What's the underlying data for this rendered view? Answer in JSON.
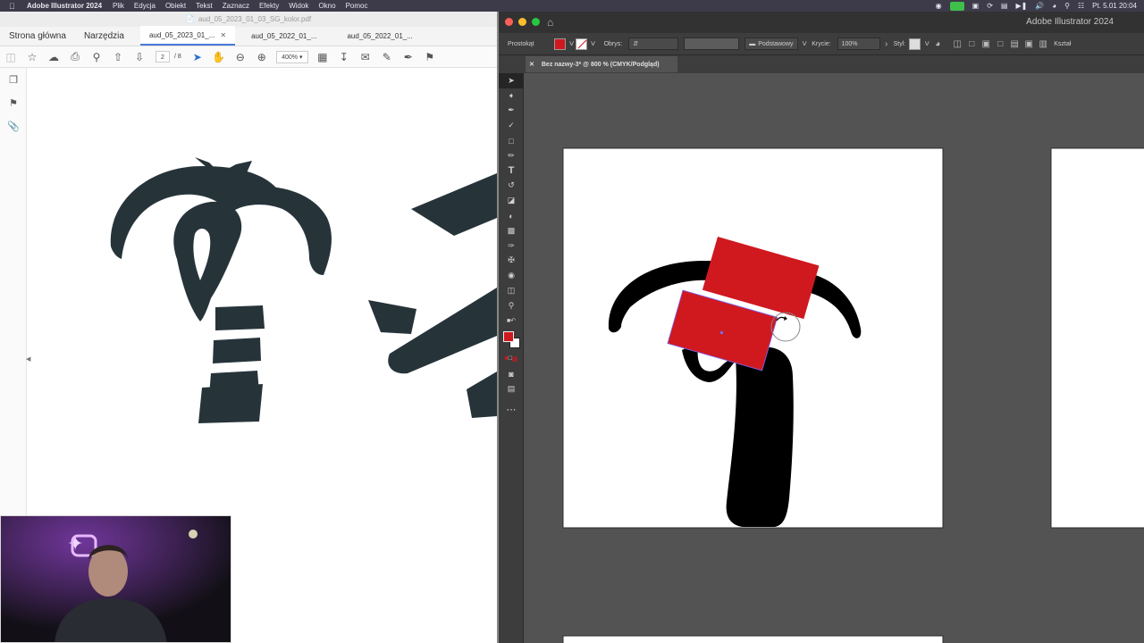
{
  "menubar": {
    "app_name": "Adobe Illustrator 2024",
    "items": [
      "Plik",
      "Edycja",
      "Obiekt",
      "Tekst",
      "Zaznacz",
      "Efekty",
      "Widok",
      "Okno",
      "Pomoc"
    ],
    "clock": "Pt. 5.01  20:04"
  },
  "pdf": {
    "window_title": "aud_05_2023_01_03_SG_kolor.pdf",
    "tabs": {
      "home": "Strona główna",
      "tools": "Narzędzia",
      "doc1": "aud_05_2023_01_...",
      "doc2": "aud_05_2022_01_...",
      "doc3": "aud_05_2022_01_..."
    },
    "page_current": "2",
    "page_total": "/ 8",
    "zoom": "400%"
  },
  "illustrator": {
    "window_title": "Adobe Illustrator 2024",
    "control": {
      "object_type": "Prostokąt",
      "stroke_label": "Obrys:",
      "brush_label": "Podstawowy",
      "opacity_label": "Krycie:",
      "opacity_value": "100%",
      "style_label": "Styl:",
      "shape_label": "Kształ"
    },
    "document_tab": "Bez nazwy-3* @ 800 % (CMYK/Podgląd)",
    "fill_color": "#d0181f",
    "tools": [
      "selection-tool",
      "direct-selection-tool",
      "pen-tool",
      "curvature-tool",
      "rectangle-tool",
      "paintbrush-tool",
      "type-tool",
      "rotate-tool",
      "eraser-tool",
      "shape-builder-tool",
      "gradient-tool",
      "eyedropper-tool",
      "blend-tool",
      "symbol-sprayer-tool",
      "artboard-tool",
      "zoom-tool"
    ]
  }
}
